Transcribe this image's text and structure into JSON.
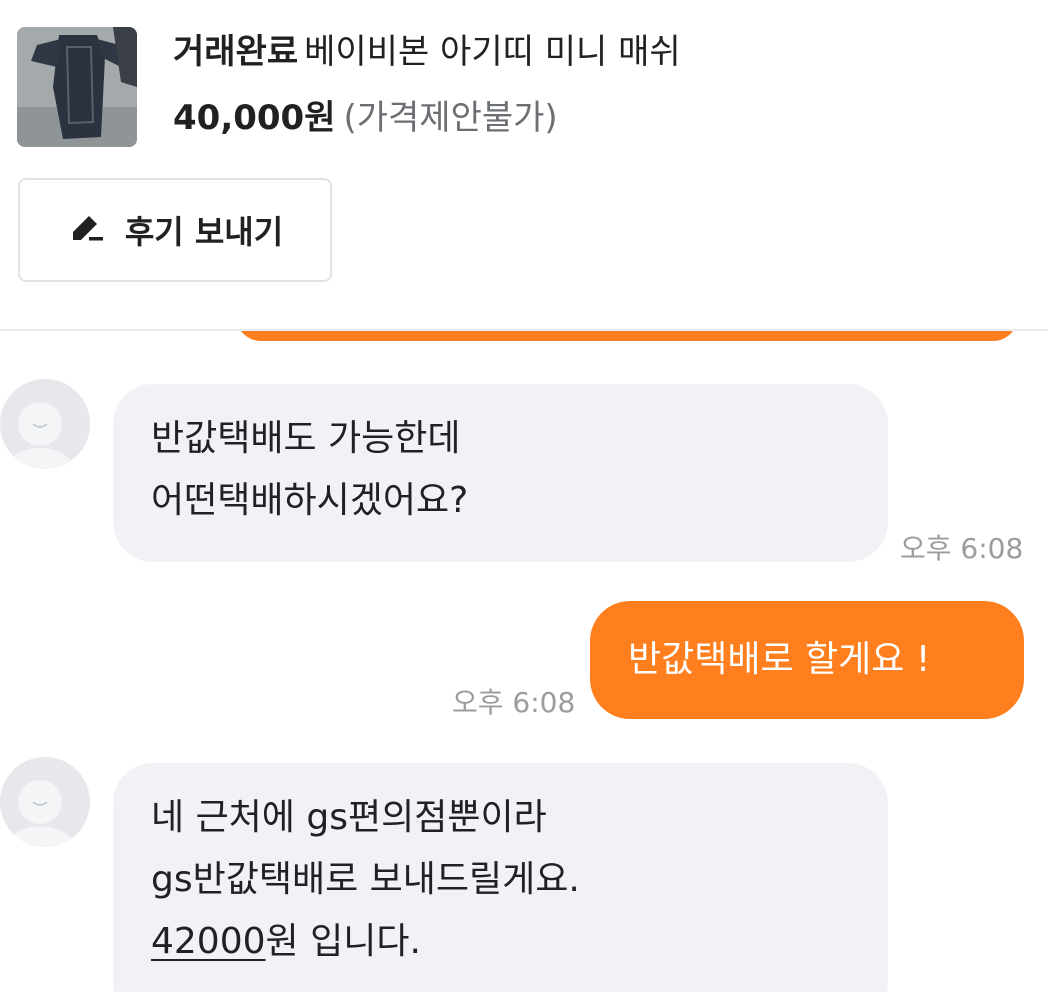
{
  "product": {
    "status": "거래완료",
    "name": "베이비본 아기띠 미니 매쉬",
    "price": "40,000원",
    "negotiation": "(가격제안불가)",
    "thumbnail_icon": "baby-carrier-photo"
  },
  "review_button": {
    "label": "후기 보내기",
    "icon": "pencil-icon"
  },
  "messages": [
    {
      "from": "other",
      "lines": [
        "반값택배도 가능한데",
        "어떤택배하시겠어요?"
      ],
      "time": "오후 6:08"
    },
    {
      "from": "me",
      "text": "반값택배로 할게요 !",
      "time": "오후 6:08"
    },
    {
      "from": "other",
      "lines": [
        "네 근처에 gs편의점뿐이라",
        "gs반값택배로 보내드릴게요."
      ],
      "line3_amount": "42000",
      "line3_rest": "원 입니다."
    }
  ],
  "colors": {
    "accent": "#ff7e1d",
    "bubble_in": "#f1f2f5",
    "time": "#9a9ca0"
  }
}
